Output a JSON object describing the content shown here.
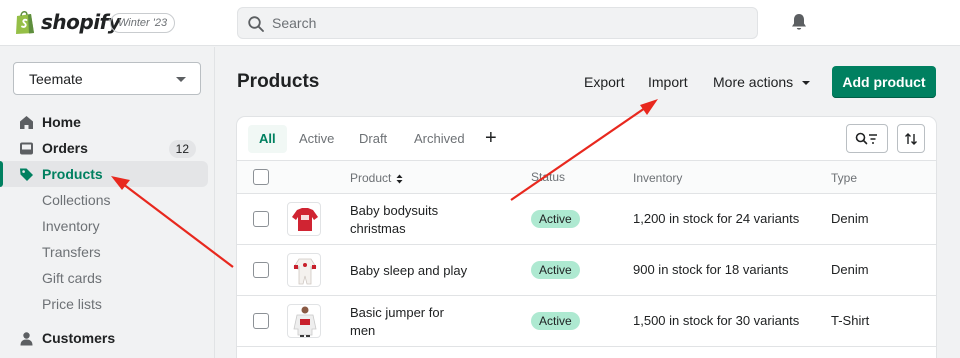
{
  "topbar": {
    "logo_text": "shopify",
    "edition": "Winter '23",
    "search_placeholder": "Search"
  },
  "sidebar": {
    "store_name": "Teemate",
    "nav": [
      {
        "label": "Home",
        "icon": "home-icon"
      },
      {
        "label": "Orders",
        "icon": "orders-icon",
        "badge": "12"
      },
      {
        "label": "Products",
        "icon": "tag-icon",
        "active": true
      },
      {
        "label": "Customers",
        "icon": "person-icon"
      }
    ],
    "product_subitems": [
      "Collections",
      "Inventory",
      "Transfers",
      "Gift cards",
      "Price lists"
    ]
  },
  "main": {
    "title": "Products",
    "actions": {
      "export": "Export",
      "import": "Import",
      "more": "More actions",
      "add": "Add product"
    },
    "tabs": [
      "All",
      "Active",
      "Draft",
      "Archived"
    ],
    "tab_add": "+",
    "columns": [
      "Product",
      "Status",
      "Inventory",
      "Type"
    ],
    "rows": [
      {
        "name": "Baby bodysuits christmas",
        "status": "Active",
        "inventory": "1,200 in stock for 24 variants",
        "type": "Denim"
      },
      {
        "name": "Baby sleep and play",
        "status": "Active",
        "inventory": "900 in stock for 18 variants",
        "type": "Denim"
      },
      {
        "name": "Basic jumper for men",
        "status": "Active",
        "inventory": "1,500 in stock for 30 variants",
        "type": "T-Shirt"
      }
    ]
  },
  "colors": {
    "brand_green": "#008060",
    "status_active_bg": "#aee9d1",
    "annotation_red": "#e8281e"
  }
}
